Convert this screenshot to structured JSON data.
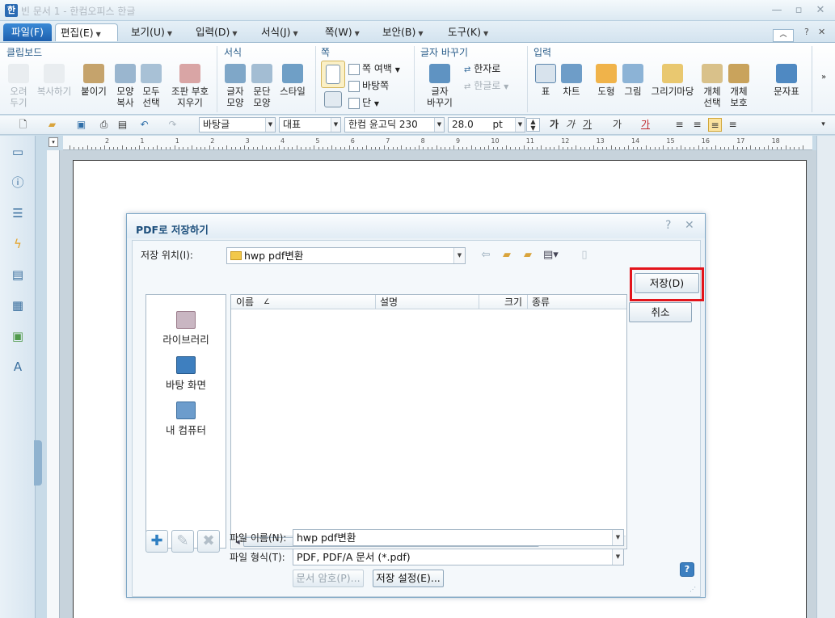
{
  "window": {
    "title": "빈 문서 1 - 한컴오피스 한글"
  },
  "menu_tabs": [
    {
      "label": "파일(F)"
    },
    {
      "label": "편집(E)"
    },
    {
      "label": "보기(U)"
    },
    {
      "label": "입력(D)"
    },
    {
      "label": "서식(J)"
    },
    {
      "label": "쪽(W)"
    },
    {
      "label": "보안(B)"
    },
    {
      "label": "도구(K)"
    }
  ],
  "ribbon": {
    "groups": {
      "clipboard": "클립보드",
      "format": "서식",
      "page": "쪽",
      "char_change": "글자 바꾸기",
      "input": "입력"
    },
    "buttons": {
      "cut": "오려\n두기",
      "copy": "복사하기",
      "paste": "붙이기",
      "shape_copy": "모양\n복사",
      "select_all": "모두\n선택",
      "remove_codes": "조판 부호\n지우기",
      "char_shape": "글자\n모양",
      "para_shape": "문단\n모양",
      "style": "스타일",
      "page_margin": "쪽 여백",
      "page_bg": "바탕쪽",
      "columns": "단",
      "char_swap": "글자\n바꾸기",
      "hanja": "한자로",
      "hangul": "한글로",
      "table": "표",
      "chart": "차트",
      "shape": "도형",
      "picture": "그림",
      "gallery": "그리기마당",
      "obj_select": "개체\n선택",
      "obj_protect": "개체\n보호",
      "symbol": "문자표"
    }
  },
  "format_toolbar": {
    "style": "바탕글",
    "lang": "대표",
    "font": "한컴 윤고딕 230",
    "size": "28.0",
    "unit": "pt"
  },
  "ruler": {
    "h_numbers": [
      "2",
      "1",
      "1",
      "2",
      "3",
      "4",
      "5",
      "6",
      "7",
      "8",
      "9",
      "10",
      "11",
      "12",
      "13",
      "14",
      "15",
      "16",
      "17",
      "18"
    ]
  },
  "dialog": {
    "title": "PDF로 저장하기",
    "location_label": "저장 위치(I):",
    "location_value": "hwp pdf변환",
    "columns": {
      "name": "이름",
      "desc": "설명",
      "size": "크기",
      "type": "종류"
    },
    "places": [
      "라이브러리",
      "바탕 화면",
      "내 컴퓨터"
    ],
    "filename_label": "파일 이름(N):",
    "filename_value": "hwp pdf변환",
    "filetype_label": "파일 형식(T):",
    "filetype_value": "PDF, PDF/A 문서 (*.pdf)",
    "password_button": "문서 암호(P)...",
    "settings_button": "저장 설정(E)...",
    "save_button": "저장(D)",
    "cancel_button": "취소",
    "highlight_color": "#e3141b"
  }
}
